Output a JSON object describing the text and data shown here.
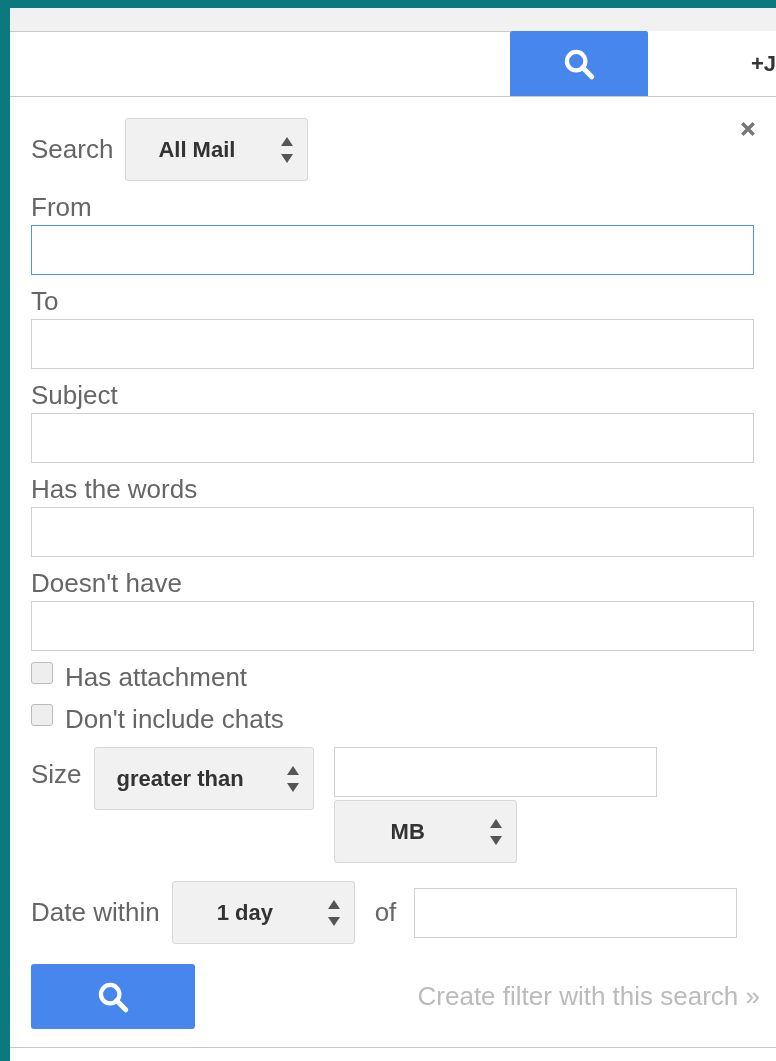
{
  "search_bar": {
    "account_label": "+J"
  },
  "search_scope": {
    "label": "Search",
    "value": "All Mail"
  },
  "fields": [
    {
      "label": "From",
      "focused": true
    },
    {
      "label": "To",
      "focused": false
    },
    {
      "label": "Subject",
      "focused": false
    },
    {
      "label": "Has the words",
      "focused": false
    },
    {
      "label": "Doesn't have",
      "focused": false
    }
  ],
  "checkboxes": [
    {
      "label": "Has attachment",
      "checked": false
    },
    {
      "label": "Don't include chats",
      "checked": false
    }
  ],
  "size": {
    "label": "Size",
    "comparator": "greater than",
    "unit": "MB"
  },
  "date_within": {
    "label": "Date within",
    "value": "1 day",
    "of_label": "of"
  },
  "create_filter_link": "Create filter with this search »"
}
